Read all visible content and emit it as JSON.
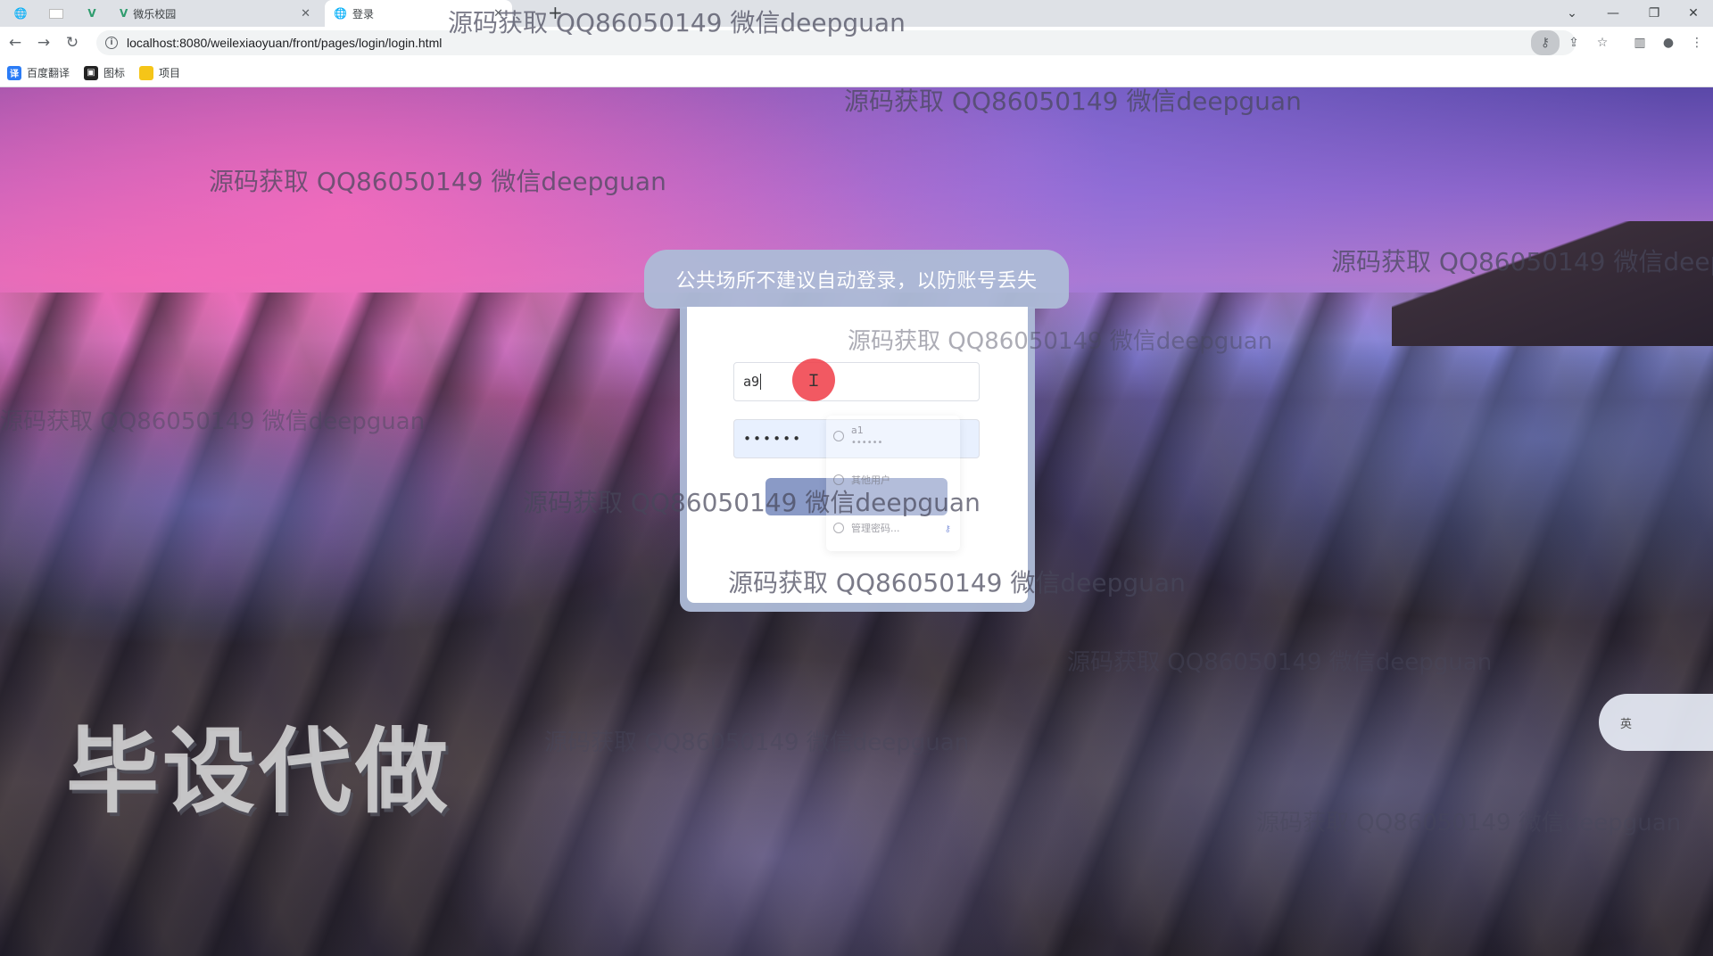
{
  "browser": {
    "tabs": [
      {
        "label": "",
        "icon": "globe-icon"
      },
      {
        "label": "",
        "icon": "blank-page-icon"
      },
      {
        "label": "",
        "icon": "vue-icon"
      },
      {
        "label": "微乐校园",
        "icon": "vue-icon",
        "close": "✕"
      },
      {
        "label": "登录",
        "icon": "globe-icon",
        "close": "✕"
      }
    ],
    "new_tab": "+",
    "url": "localhost:8080/weilexiaoyuan/front/pages/login/login.html",
    "bookmarks": [
      {
        "label": "百度翻译",
        "icon": "translate-icon",
        "color": "#2b7cf6"
      },
      {
        "label": "图标",
        "icon": "image-icon",
        "color": "#222222"
      },
      {
        "label": "项目",
        "icon": "folder-icon",
        "color": "#f5c518"
      }
    ]
  },
  "login": {
    "notice": "公共场所不建议自动登录，以防账号丢失",
    "username_value": "a9",
    "password_value": "••••••",
    "autofill": {
      "entry_user": "a1",
      "entry_pass": "••••••",
      "other_user": "其他用户",
      "manage": "管理密码..."
    }
  },
  "watermarks": {
    "text": "源码获取 QQ86050149 微信deepguan",
    "big": "毕设代做"
  },
  "ime": {
    "label": "英"
  }
}
